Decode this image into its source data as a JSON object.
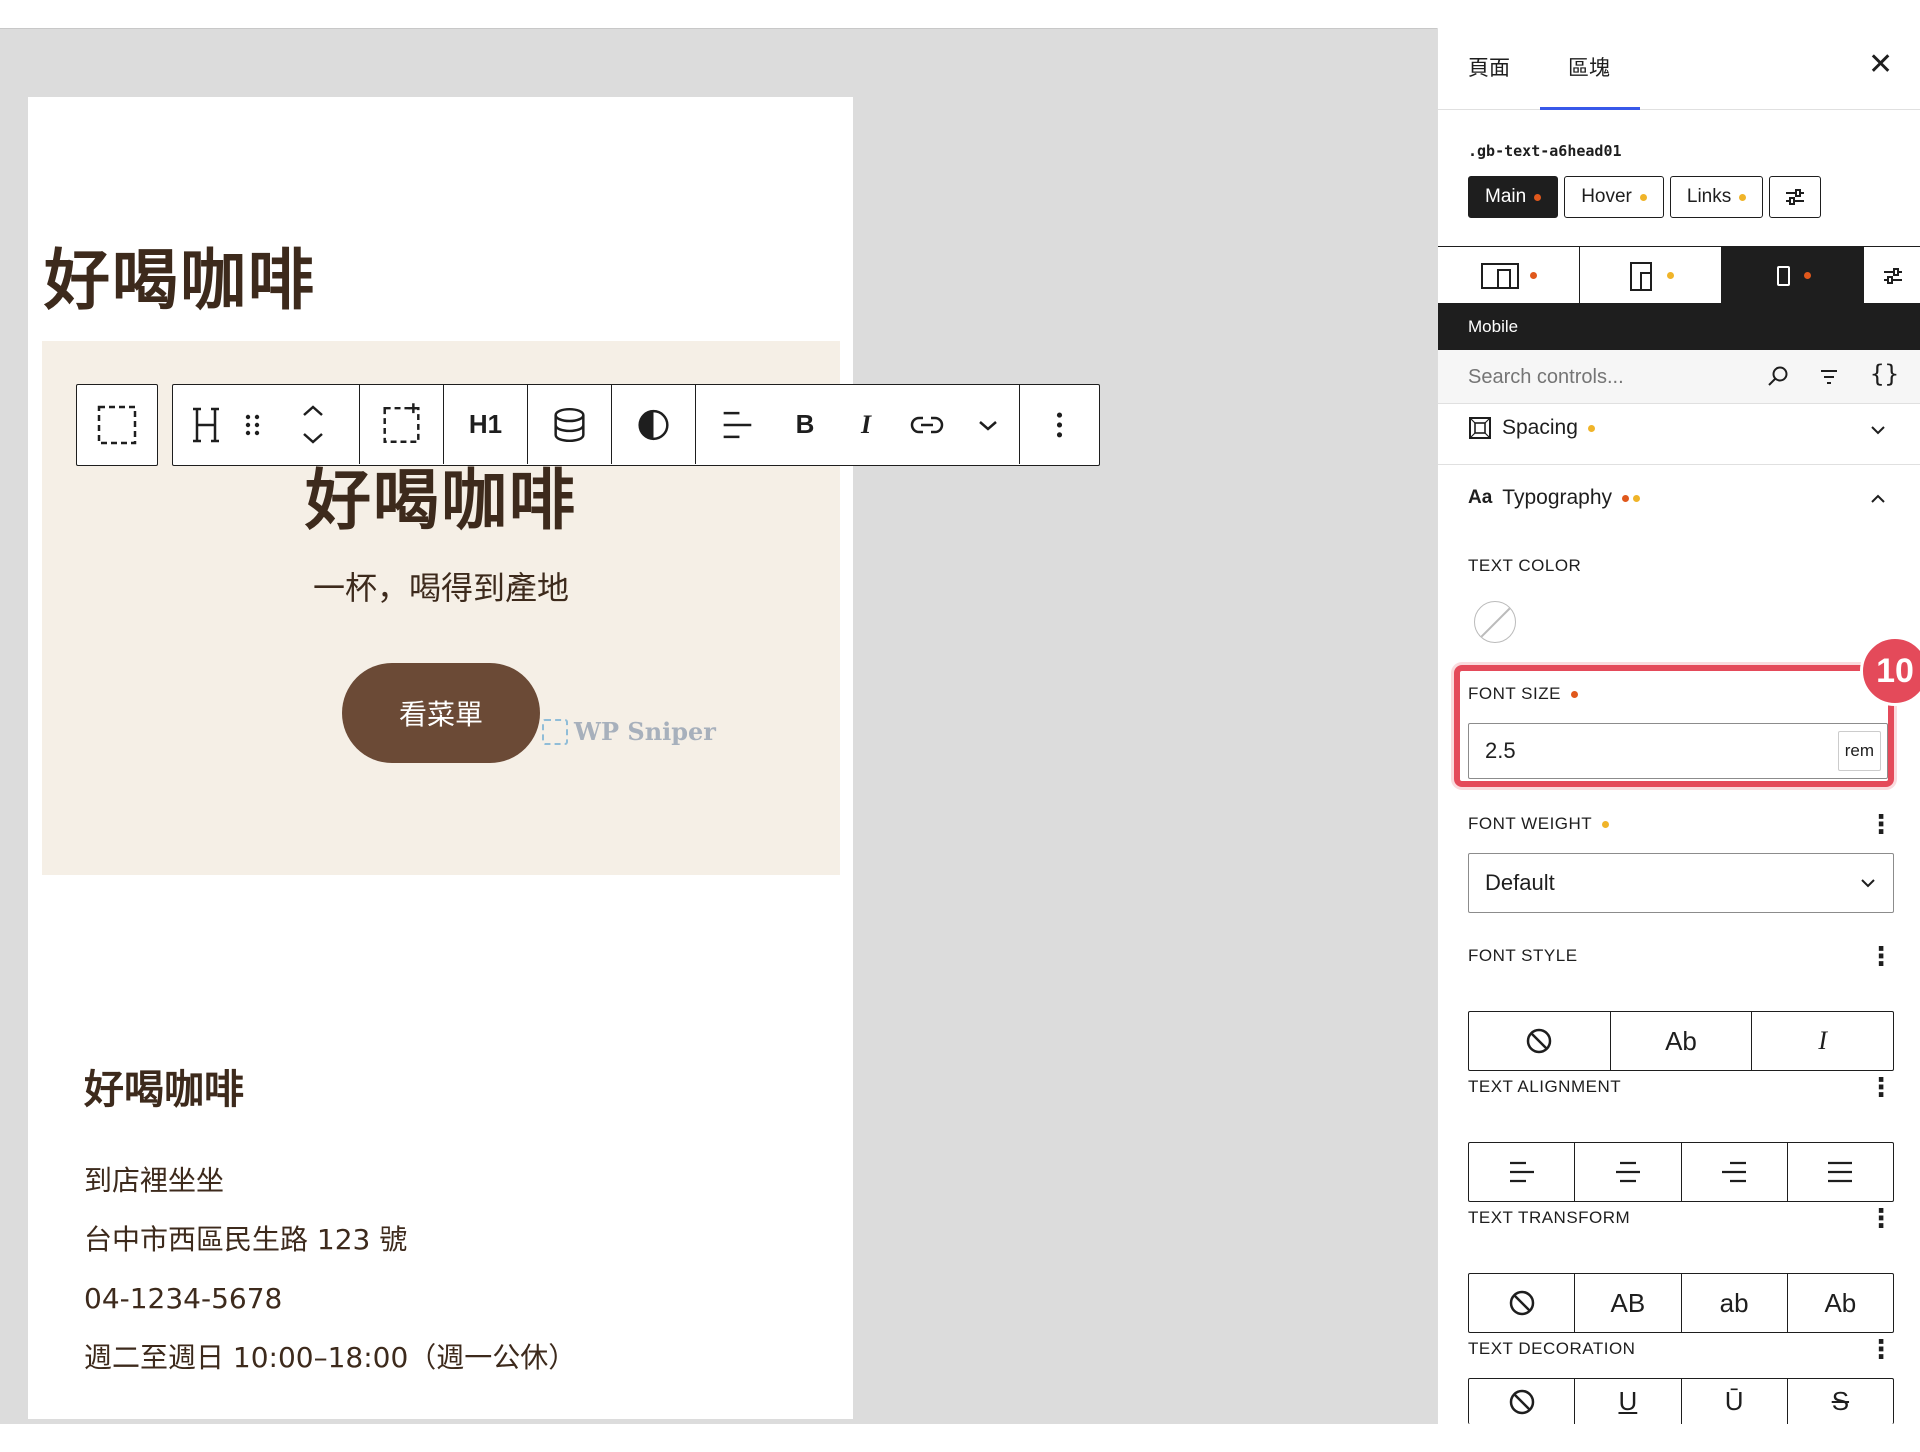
{
  "canvas": {
    "page_title": "好喝咖啡",
    "hero": {
      "title": "好喝咖啡",
      "subtitle": "一杯，喝得到產地",
      "button_label": "看菜單",
      "watermark": "WP Sniper"
    },
    "footer": {
      "title": "好喝咖啡",
      "lines": [
        "到店裡坐坐",
        "台中市西區民生路 123 號",
        "04-1234-5678",
        "週二至週日 10:00–18:00（週一公休）"
      ]
    },
    "toolbar": {
      "heading_level": "H1",
      "icons": [
        "select-parent-icon",
        "heading-block-icon",
        "drag-handle-icon",
        "move-up-down-icon",
        "group-select-icon",
        "database-icon",
        "contrast-icon",
        "align-left-icon",
        "bold-icon",
        "italic-icon",
        "link-icon",
        "more-chevron-icon",
        "options-kebab-icon"
      ],
      "bold_label": "B",
      "italic_label": "I"
    }
  },
  "sidebar": {
    "tabs": [
      "頁面",
      "區塊"
    ],
    "active_tab": "區塊",
    "close_label": "✕",
    "class_name": ".gb-text-a6head01",
    "states": [
      {
        "label": "Main",
        "dot": "red",
        "active": true
      },
      {
        "label": "Hover",
        "dot": "orange",
        "active": false
      },
      {
        "label": "Links",
        "dot": "orange",
        "active": false
      }
    ],
    "devices": [
      {
        "icon": "desktop-tablet-icon",
        "dot": "red"
      },
      {
        "icon": "tablet-icon",
        "dot": "orange"
      },
      {
        "icon": "mobile-icon",
        "dot": "red",
        "active": true
      }
    ],
    "device_label": "Mobile",
    "search_placeholder": "Search controls...",
    "spacing_panel": "Spacing",
    "typography_panel": "Typography",
    "typography_prefix": "Aa",
    "text_color_label": "TEXT COLOR",
    "font_size_label": "FONT SIZE",
    "font_size_value": "2.5",
    "font_size_unit": "rem",
    "step_badge": "10",
    "font_weight_label": "FONT WEIGHT",
    "font_weight_value": "Default",
    "font_style_label": "FONT STYLE",
    "font_style_options": [
      "⊘",
      "Ab",
      "I"
    ],
    "text_alignment_label": "TEXT ALIGNMENT",
    "text_transform_label": "TEXT TRANSFORM",
    "text_transform_options": [
      "⊘",
      "AB",
      "ab",
      "Ab"
    ],
    "text_decoration_label": "TEXT DECORATION",
    "text_decoration_options": [
      "⊘",
      "U",
      "Ū",
      "S"
    ]
  },
  "colors": {
    "accent": "#3858e9",
    "highlight": "#e44a5a",
    "brown": "#6b4a36",
    "text_dark": "#3d2a1c",
    "hero_bg": "#f5efe6",
    "canvas_bg": "#dcdcdc",
    "dot_red": "#e0581c",
    "dot_orange": "#f0b429"
  }
}
